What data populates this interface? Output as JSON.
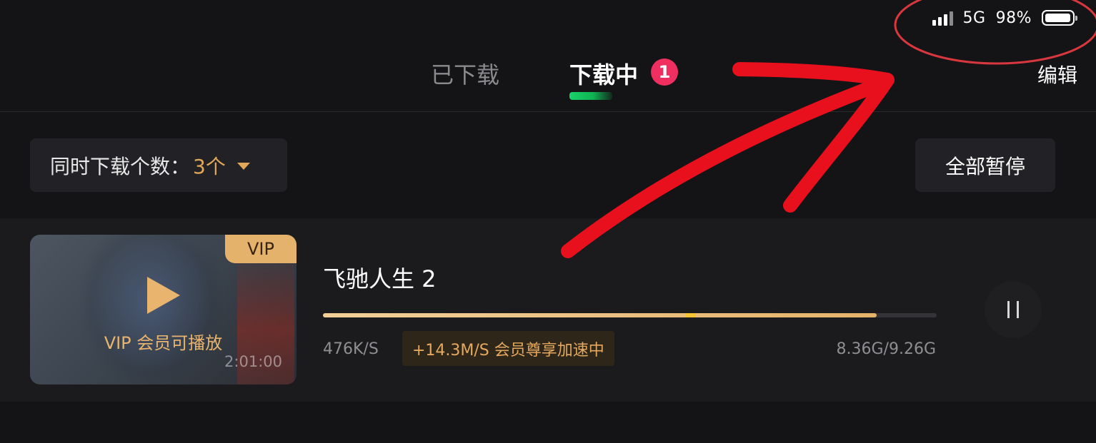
{
  "status_bar": {
    "network": "5G",
    "battery": "98%",
    "battery_level": 0.98,
    "icons": [
      "signal-icon",
      "battery-icon"
    ]
  },
  "tabs": [
    {
      "label": "已下载",
      "active": false
    },
    {
      "label": "下载中",
      "active": true,
      "badge": "1"
    }
  ],
  "header": {
    "edit_label": "编辑"
  },
  "controls": {
    "concurrent_label": "同时下载个数：",
    "concurrent_value": "3个",
    "pause_all_label": "全部暂停"
  },
  "download_item": {
    "title": "飞驰人生 2",
    "vip_tag": "VIP",
    "vip_play_text": "VIP 会员可播放",
    "duration": "2:01:00",
    "speed": "476K/S",
    "boost_text": "+14.3M/S 会员尊享加速中",
    "size": "8.36G/9.26G",
    "progress": 0.902,
    "progress_marker": 0.59
  },
  "colors": {
    "accent_gold": "#e5b26b",
    "badge_red": "#ee2f5f",
    "indicator_green": "#19d26a",
    "annotation_red": "#e8101c"
  }
}
